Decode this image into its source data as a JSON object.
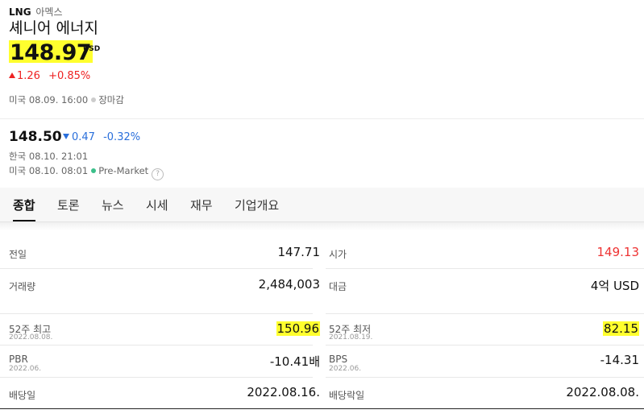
{
  "header": {
    "symbol": "LNG",
    "exchange": "아멕스",
    "company_name": "셰니어 에너지",
    "price": "148.97",
    "currency": "USD",
    "change": "1.26",
    "change_pct": "+0.85%",
    "market_time": "미국 08.09. 16:00",
    "market_status": "장마감"
  },
  "premarket": {
    "price": "148.50",
    "change": "0.47",
    "change_pct": "-0.32%",
    "korea_time": "한국 08.10. 21:01",
    "us_time": "미국 08.10. 08:01",
    "session": "Pre-Market",
    "help": "?"
  },
  "tabs": [
    "종합",
    "토론",
    "뉴스",
    "시세",
    "재무",
    "기업개요"
  ],
  "stats": {
    "prev_close_label": "전일",
    "prev_close": "147.71",
    "open_label": "시가",
    "open": "149.13",
    "volume_label": "거래량",
    "volume": "2,484,003",
    "amount_label": "대금",
    "amount": "4억 USD",
    "high52_label": "52주 최고",
    "high52_date": "2022.08.08.",
    "high52": "150.96",
    "low52_label": "52주 최저",
    "low52_date": "2021.08.19.",
    "low52": "82.15",
    "pbr_label": "PBR",
    "pbr_date": "2022.06.",
    "pbr": "-10.41배",
    "bps_label": "BPS",
    "bps_date": "2022.06.",
    "bps": "-14.31",
    "div_date_label": "배당일",
    "div_date": "2022.08.16.",
    "exdiv_label": "배당락일",
    "exdiv_date": "2022.08.08."
  },
  "colors": {
    "up": "#e22222",
    "down": "#2a6fdb",
    "highlight": "#ffff2e"
  }
}
